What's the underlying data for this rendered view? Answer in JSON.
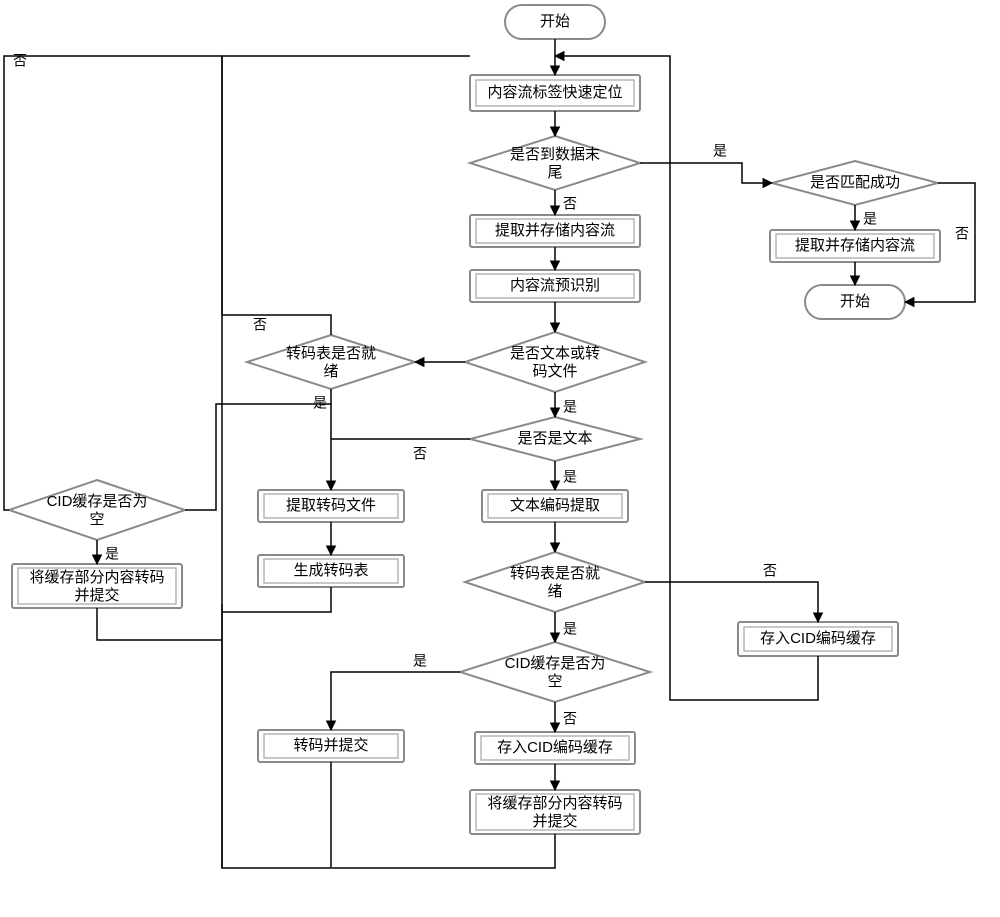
{
  "nodes": {
    "start": "开始",
    "p1": "内容流标签快速定位",
    "d1": "是否到数据末尾",
    "p2": "提取并存储内容流",
    "p3": "内容流预识别",
    "d2": "是否文本或转码文件",
    "d3": "是否是文本",
    "p4": "文本编码提取",
    "d4": "转码表是否就绪",
    "d5": "CID缓存是否为空",
    "p5": "存入CID编码缓存",
    "p6": "将缓存部分内容转码并提交",
    "p_left_trans": "转码并提交",
    "p_ext": "提取转码文件",
    "p_gen": "生成转码表",
    "d_tc": "转码表是否就绪",
    "p_cid_right": "存入CID编码缓存",
    "d_cid_left": "CID缓存是否为空",
    "p_cache_left": "将缓存部分内容转码并提交",
    "d_match": "是否匹配成功",
    "p_extract_r": "提取并存储内容流",
    "end": "开始"
  },
  "labels": {
    "yes": "是",
    "no": "否"
  }
}
